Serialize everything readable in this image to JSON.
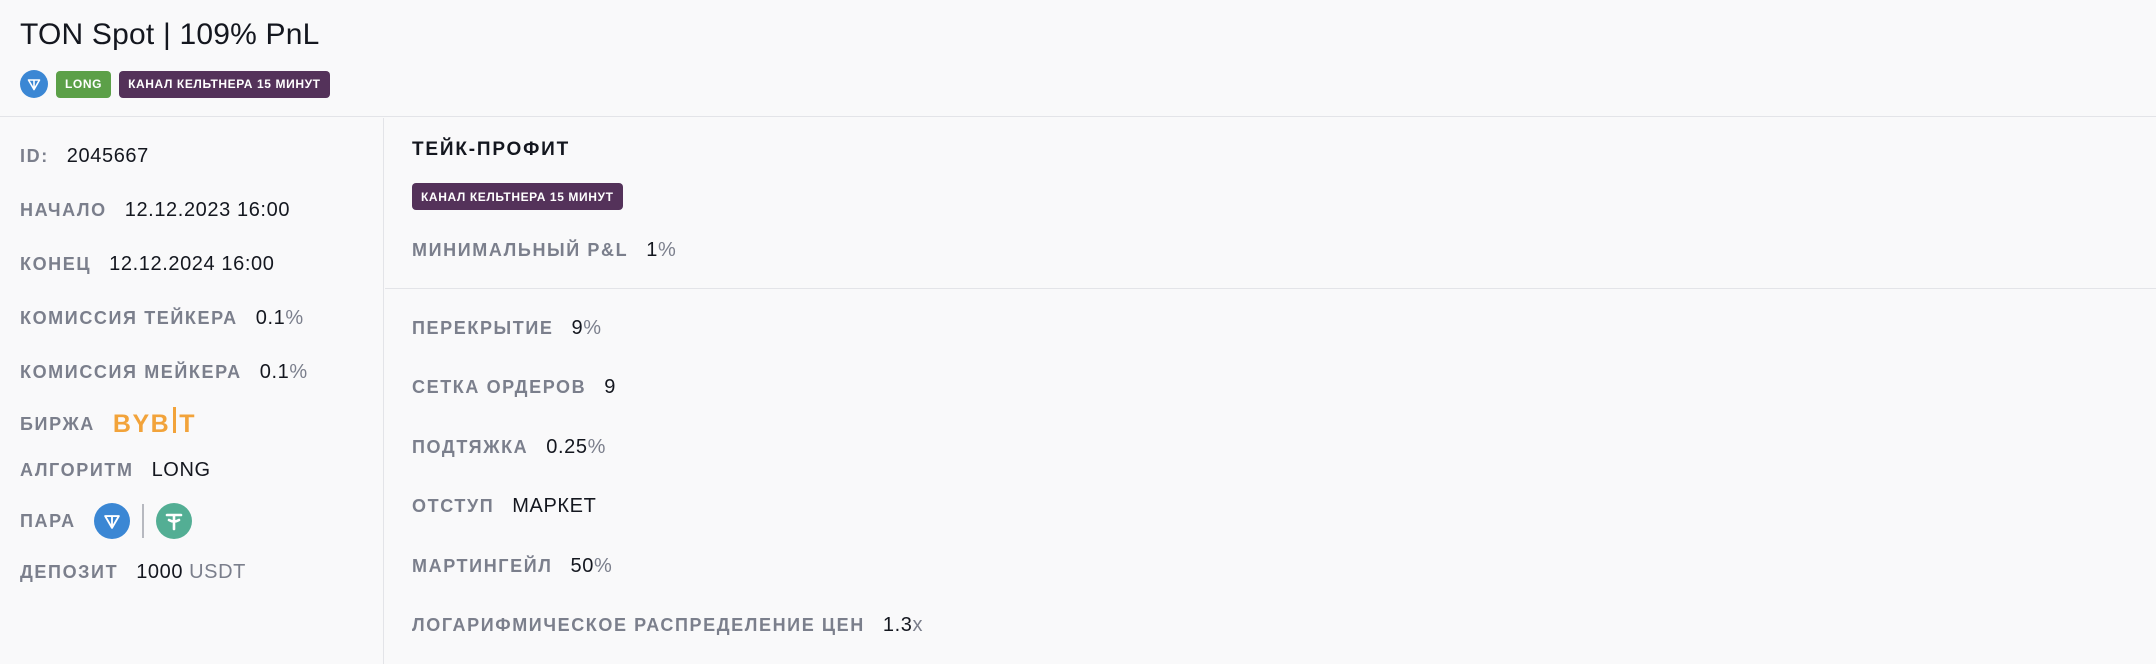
{
  "header": {
    "title": "TON Spot | 109% PnL",
    "tags": {
      "long": "LONG",
      "strategy": "КАНАЛ КЕЛЬТНЕРА 15 МИНУТ"
    },
    "coin_icon": "ton-icon"
  },
  "details": {
    "id": {
      "label": "ID:",
      "value": "2045667"
    },
    "start": {
      "label": "НАЧАЛО",
      "value": "12.12.2023 16:00"
    },
    "end": {
      "label": "КОНЕЦ",
      "value": "12.12.2024 16:00"
    },
    "taker_fee": {
      "label": "КОМИССИЯ ТЕЙКЕРА",
      "value": "0.1",
      "unit": "%"
    },
    "maker_fee": {
      "label": "КОМИССИЯ МЕЙКЕРА",
      "value": "0.1",
      "unit": "%"
    },
    "exchange": {
      "label": "БИРЖА",
      "logo": "BYBIT"
    },
    "algorithm": {
      "label": "АЛГОРИТМ",
      "value": "LONG"
    },
    "pair": {
      "label": "ПАРА",
      "base_icon": "ton-icon",
      "quote_icon": "tether-icon"
    },
    "deposit": {
      "label": "ДЕПОЗИТ",
      "value": "1000",
      "unit": "USDT"
    }
  },
  "take_profit": {
    "title": "ТЕЙК-ПРОФИТ",
    "tag": "КАНАЛ КЕЛЬТНЕРА 15 МИНУТ",
    "min_pnl": {
      "label": "МИНИМАЛЬНЫЙ P&L",
      "value": "1",
      "unit": "%"
    }
  },
  "grid": {
    "overlap": {
      "label": "ПЕРЕКРЫТИЕ",
      "value": "9",
      "unit": "%"
    },
    "orders": {
      "label": "СЕТКА ОРДЕРОВ",
      "value": "9"
    },
    "pullup": {
      "label": "ПОДТЯЖКА",
      "value": "0.25",
      "unit": "%"
    },
    "offset": {
      "label": "ОТСТУП",
      "value": "МАРКЕТ"
    },
    "martingale": {
      "label": "МАРТИНГЕЙЛ",
      "value": "50",
      "unit": "%"
    },
    "log_distribution": {
      "label": "ЛОГАРИФМИЧЕСКОЕ РАСПРЕДЕЛЕНИЕ ЦЕН",
      "value": "1.3",
      "unit": "x"
    }
  },
  "colors": {
    "long_tag": "#5ca048",
    "strategy_tag": "#54325a",
    "ton": "#3b87d4",
    "tether": "#53ae94",
    "bybit": "#f2a33a"
  }
}
